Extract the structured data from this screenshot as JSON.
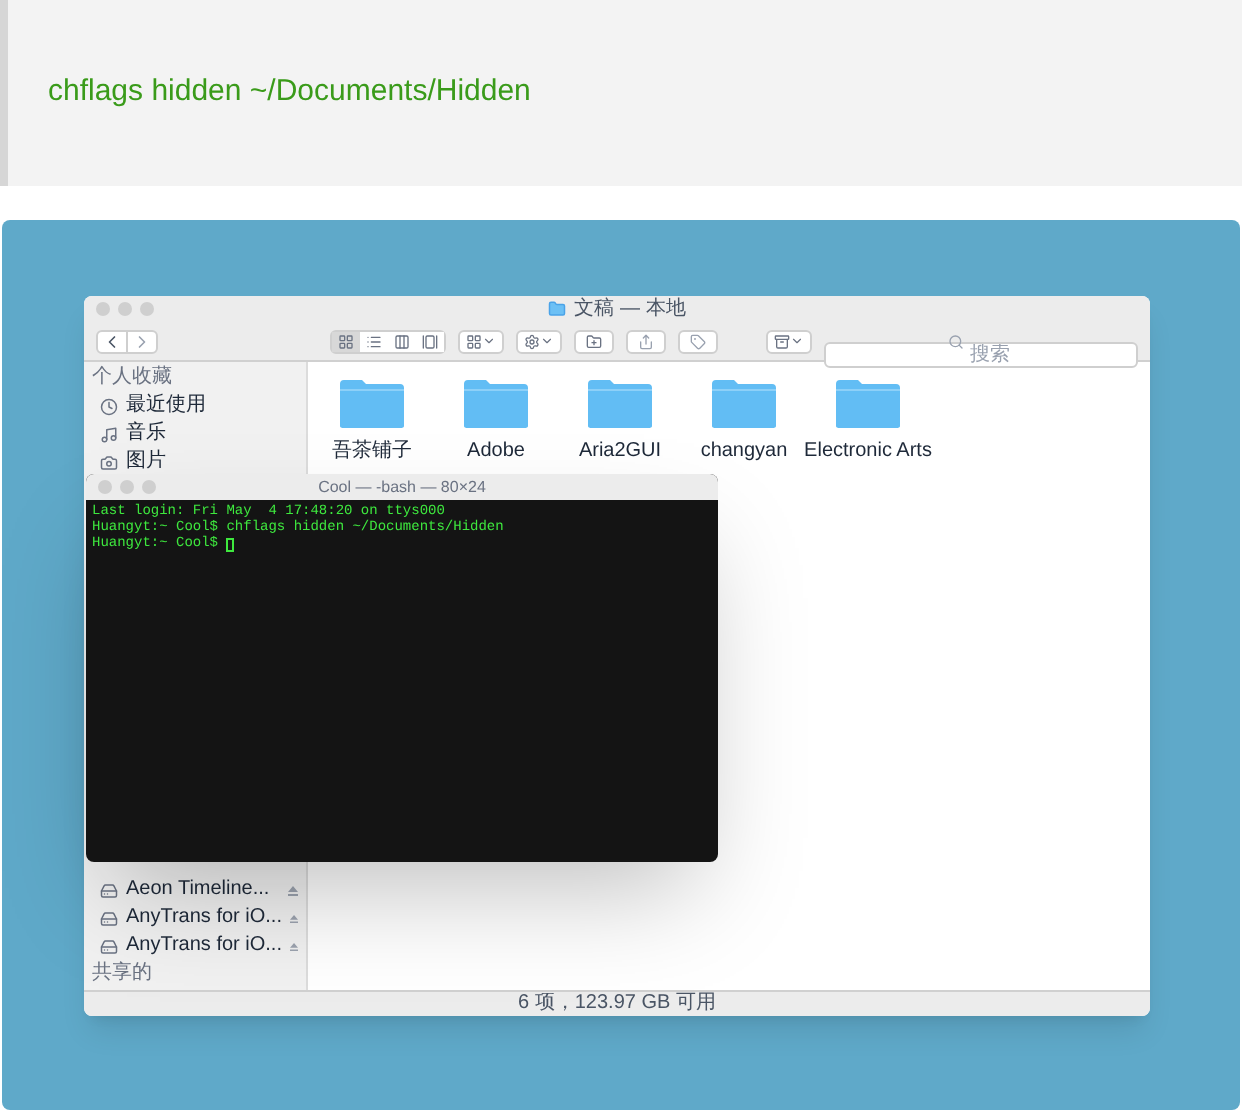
{
  "code_block": {
    "text": "chflags hidden ~/Documents/Hidden"
  },
  "screenshot": {
    "finder": {
      "title": "文稿 — 本地",
      "view_modes": [
        {
          "kind": "icons",
          "selected": true
        },
        {
          "kind": "list",
          "selected": false
        },
        {
          "kind": "columns",
          "selected": false
        },
        {
          "kind": "gallery",
          "selected": false
        }
      ],
      "search": {
        "placeholder": "搜索"
      },
      "sidebar_top": {
        "heading": "个人收藏",
        "items": [
          {
            "label": "最近使用",
            "kind": "recent"
          },
          {
            "label": "音乐",
            "kind": "music"
          },
          {
            "label": "图片",
            "kind": "pictures"
          }
        ]
      },
      "sidebar_bottom": {
        "items": [
          {
            "label": "Aeon Timeline...",
            "kind": "device"
          },
          {
            "label": "AnyTrans for iO...",
            "kind": "device"
          },
          {
            "label": "AnyTrans for iO...",
            "kind": "device"
          }
        ],
        "heading": "共享的"
      },
      "folders": [
        {
          "name": "吾茶铺子"
        },
        {
          "name": "Adobe"
        },
        {
          "name": "Aria2GUI"
        },
        {
          "name": "changyan"
        },
        {
          "name": "Electronic Arts"
        }
      ],
      "status": "6 项，123.97 GB 可用"
    },
    "terminal": {
      "title": "Cool — -bash — 80×24",
      "lines": [
        "Last login: Fri May  4 17:48:20 on ttys000",
        "Huangyt:~ Cool$ chflags hidden ~/Documents/Hidden",
        "Huangyt:~ Cool$ "
      ]
    }
  }
}
